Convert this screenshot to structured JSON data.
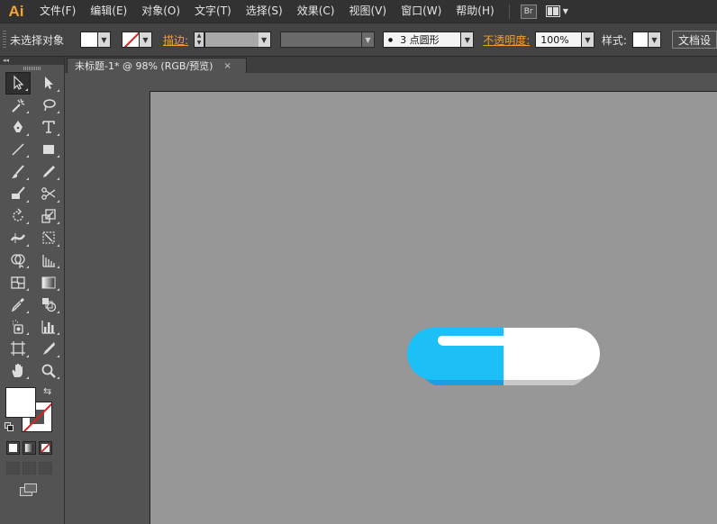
{
  "app": {
    "logo": "Ai"
  },
  "menu": {
    "items": [
      "文件(F)",
      "编辑(E)",
      "对象(O)",
      "文字(T)",
      "选择(S)",
      "效果(C)",
      "视图(V)",
      "窗口(W)",
      "帮助(H)"
    ],
    "bridge_label": "Br"
  },
  "control": {
    "selection_label": "未选择对象",
    "stroke_label": "描边:",
    "brush_label": "3 点圆形",
    "opacity_label": "不透明度:",
    "opacity_value": "100%",
    "style_label": "样式:",
    "doc_button": "文档设"
  },
  "document": {
    "tab_title": "未标题-1* @ 98% (RGB/预览)",
    "tab_close": "×"
  },
  "toolbar": {
    "collapse_glyph": "◂◂",
    "swap_glyph": "⇆"
  },
  "artwork": {
    "left_color": "#1dbff7",
    "left_shadow": "#1a9fe0",
    "right_color": "#ffffff",
    "right_shadow": "#c8c8c8"
  }
}
